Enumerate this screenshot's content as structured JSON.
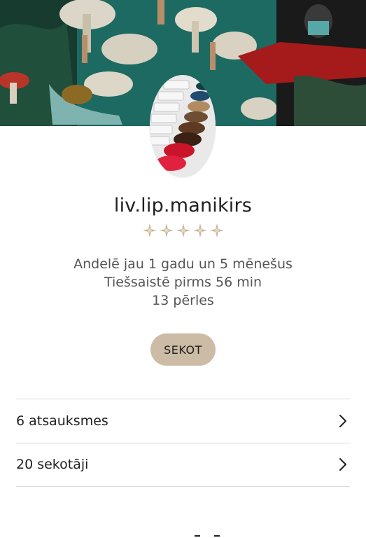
{
  "profile": {
    "username": "liv.lip.manikirs",
    "rating_stars": 5
  },
  "info": {
    "member_since": "Andelē jau 1 gadu un 5 mēnešus",
    "last_online": "Tiešsaistē pirms 56 min",
    "pearls": "13 pērles"
  },
  "actions": {
    "follow_label": "SEKOT"
  },
  "links": [
    {
      "label": "6 atsauksmes"
    },
    {
      "label": "20 sekotāji"
    }
  ],
  "icons": {
    "star": "star-icon",
    "chevron": "chevron-right-icon"
  },
  "colors": {
    "follow_button": "#ccbca5",
    "star": "#c9b89c",
    "banner_teal": "#1f6b63"
  }
}
